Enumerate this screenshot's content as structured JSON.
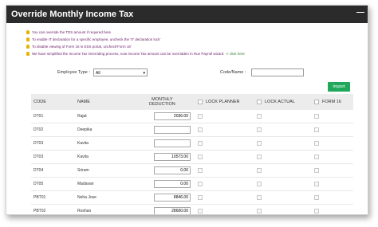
{
  "window": {
    "title": "Override Monthly Income Tax",
    "minimize_glyph": "—"
  },
  "notes": [
    {
      "text": "You can override the TDS amount if required here"
    },
    {
      "text": "To enable IT declaration for a specific employee, uncheck the 'IT declaration lock'"
    },
    {
      "text": "To disable viewing of Form 16 in ESS portal, uncheck'Form 16'"
    },
    {
      "text": "We have simplified the Income Tax Overriding process, now Income Tax amount can be overridden in Run Payroll wizard",
      "link": "-> click here"
    }
  ],
  "filters": {
    "employee_type_label": "Employee Type :",
    "employee_type_value": "All",
    "code_name_label": "Code/Name :",
    "code_name_value": ""
  },
  "import_label": "Import",
  "grid": {
    "headers": {
      "code": "CODE",
      "name": "NAME",
      "monthly_line1": "MONTHLY",
      "monthly_line2": "DEDUCTION",
      "lock_planner": "LOCK PLANNER",
      "lock_actual": "LOCK ACTUAL",
      "form16": "FORM 16"
    },
    "rows": [
      {
        "code": "DT01",
        "name": "Rajat",
        "amount": "2036.00"
      },
      {
        "code": "DT02",
        "name": "Deepika",
        "amount": ""
      },
      {
        "code": "DT03",
        "name": "Kavita",
        "amount": ""
      },
      {
        "code": "DT03",
        "name": "Kavita",
        "amount": "10573.00"
      },
      {
        "code": "DT04",
        "name": "Sriram",
        "amount": "0.00"
      },
      {
        "code": "DT05",
        "name": "Madavan",
        "amount": "0.00"
      },
      {
        "code": "PBT01",
        "name": "Neha Jose",
        "amount": "8846.00"
      },
      {
        "code": "PBT02",
        "name": "Roshan",
        "amount": "28600.00"
      }
    ]
  },
  "colors": {
    "titlebar": "#2b2b2b",
    "note_text": "#6a1b6a",
    "link": "#2e7d32",
    "import_button": "#1fa85a",
    "header_row": "#ececec"
  }
}
